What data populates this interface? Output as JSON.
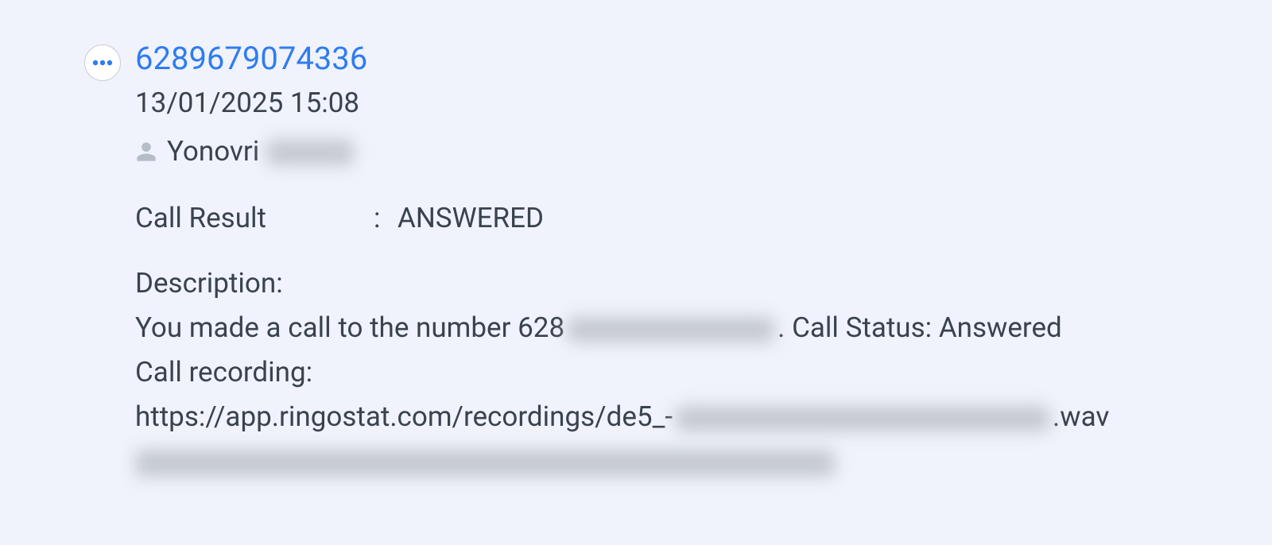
{
  "header": {
    "phone": "6289679074336",
    "timestamp": "13/01/2025 15:08",
    "author_first": "Yonovri"
  },
  "result": {
    "label": "Call Result",
    "separator": ":",
    "value": "ANSWERED"
  },
  "description": {
    "heading": "Description:",
    "line1_pre": "You made a call to the number 628",
    "line1_post": ". Call Status: Answered",
    "line2": "Call recording:",
    "line3_pre": "https://app.ringostat.com/recordings/de5_-",
    "line3_post": ".wav"
  }
}
